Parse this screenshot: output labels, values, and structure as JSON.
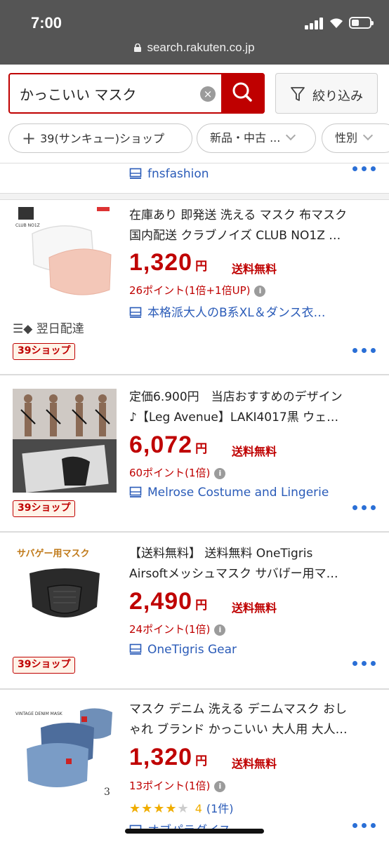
{
  "status_bar": {
    "time": "7:00",
    "url": "search.rakuten.co.jp"
  },
  "search": {
    "query": "かっこいい マスク",
    "clear_label": "×",
    "filter_label": "絞り込み"
  },
  "chips": [
    {
      "label": "39(サンキュー)ショップ"
    },
    {
      "label": "新品・中古 ..."
    },
    {
      "label": "性別"
    }
  ],
  "partial_shop": "fnsfashion",
  "products": [
    {
      "title_line1": "在庫あり 即発送 洗える マスク 布マスク",
      "title_line2": "国内配送 クラブノイズ CLUB NO1Z …",
      "price": "1,320",
      "yen": "円",
      "shipping": "送料無料",
      "points": "26ポイント(1倍+1倍UP)",
      "shop": "本格派大人のB系XL＆ダンス衣…",
      "delivery": "翌日配達",
      "badge": "39ショップ",
      "image_text": "CLUB NO1Z"
    },
    {
      "title_line1": "定価6.900円　当店おすすめのデザイン",
      "title_line2": "♪【Leg Avenue】LAKI4017黒 ウェ…",
      "price": "6,072",
      "yen": "円",
      "shipping": "送料無料",
      "points": "60ポイント(1倍)",
      "shop": "Melrose Costume and Lingerie",
      "badge": "39ショップ"
    },
    {
      "title_line1": "【送料無料】 送料無料 OneTigris",
      "title_line2": "Airsoftメッシュマスク サバげー用マ…",
      "price": "2,490",
      "yen": "円",
      "shipping": "送料無料",
      "points": "24ポイント(1倍)",
      "shop": "OneTigris Gear",
      "badge": "39ショップ",
      "image_text": "サバゲー用マスク"
    },
    {
      "title_line1": "マスク デニム 洗える デニムマスク おし",
      "title_line2": "ゃれ ブランド かっこいい 大人用 大人…",
      "price": "1,320",
      "yen": "円",
      "shipping": "送料無料",
      "points": "13ポイント(1倍)",
      "rating": "4",
      "review_count": "(1件)",
      "rating_value": 4,
      "shop": "オブパラダイス",
      "image_text": "VINTAGE DENIM MASK",
      "image_number": "3"
    }
  ],
  "colors": {
    "brand_red": "#bf0000",
    "link_blue": "#2a5bb8",
    "status_gray": "#555555"
  }
}
